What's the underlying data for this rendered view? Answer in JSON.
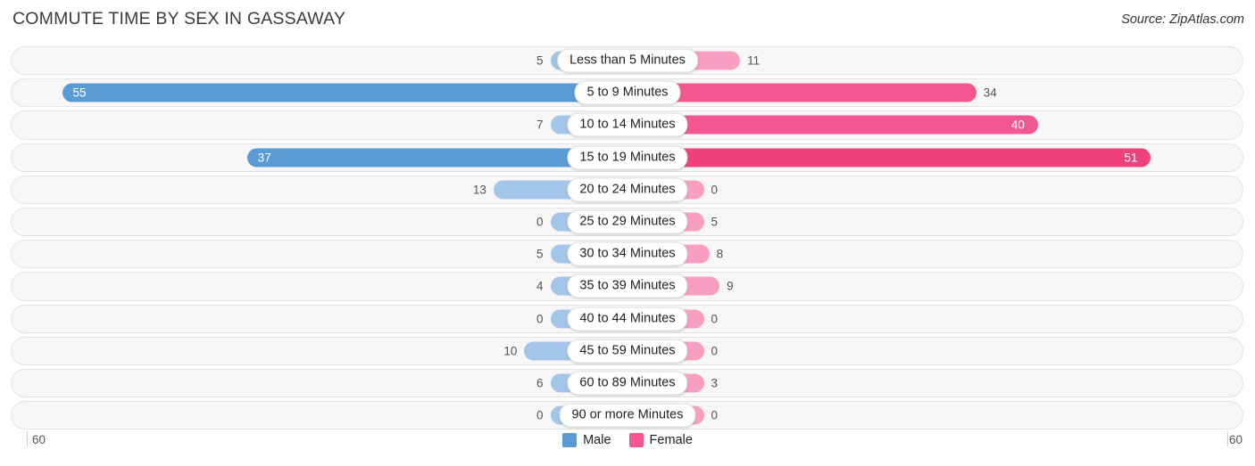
{
  "header": {
    "title": "COMMUTE TIME BY SEX IN GASSAWAY",
    "source": "Source: ZipAtlas.com"
  },
  "legend": {
    "male_label": "Male",
    "female_label": "Female",
    "male_color": "#5b9bd5",
    "female_color": "#f2588f"
  },
  "axis": {
    "left_tick": "60",
    "right_tick": "60",
    "max": 60
  },
  "chart_data": {
    "type": "bar",
    "title": "COMMUTE TIME BY SEX IN GASSAWAY",
    "subtitle": "Source: ZipAtlas.com",
    "orientation": "horizontal-diverging",
    "xlabel": "",
    "ylabel": "",
    "xlim": [
      60,
      60
    ],
    "grid": false,
    "legend_position": "bottom-center",
    "categories": [
      "Less than 5 Minutes",
      "5 to 9 Minutes",
      "10 to 14 Minutes",
      "15 to 19 Minutes",
      "20 to 24 Minutes",
      "25 to 29 Minutes",
      "30 to 34 Minutes",
      "35 to 39 Minutes",
      "40 to 44 Minutes",
      "45 to 59 Minutes",
      "60 to 89 Minutes",
      "90 or more Minutes"
    ],
    "series": [
      {
        "name": "Male",
        "values": [
          5,
          55,
          7,
          37,
          13,
          0,
          5,
          4,
          0,
          10,
          6,
          0
        ]
      },
      {
        "name": "Female",
        "values": [
          11,
          34,
          40,
          51,
          0,
          5,
          8,
          9,
          0,
          0,
          3,
          0
        ]
      }
    ]
  },
  "rows": [
    {
      "category": "Less than 5 Minutes",
      "male": 5,
      "female": 11,
      "male_text": "5",
      "female_text": "11",
      "male_inside": false,
      "female_inside": false,
      "male_shade": "light",
      "female_shade": "light"
    },
    {
      "category": "5 to 9 Minutes",
      "male": 55,
      "female": 34,
      "male_text": "55",
      "female_text": "34",
      "male_inside": true,
      "female_inside": false,
      "male_shade": "strong",
      "female_shade": "strong"
    },
    {
      "category": "10 to 14 Minutes",
      "male": 7,
      "female": 40,
      "male_text": "7",
      "female_text": "40",
      "male_inside": false,
      "female_inside": true,
      "male_shade": "light",
      "female_shade": "strong"
    },
    {
      "category": "15 to 19 Minutes",
      "male": 37,
      "female": 51,
      "male_text": "37",
      "female_text": "51",
      "male_inside": true,
      "female_inside": true,
      "male_shade": "strong",
      "female_shade": "strongest"
    },
    {
      "category": "20 to 24 Minutes",
      "male": 13,
      "female": 0,
      "male_text": "13",
      "female_text": "0",
      "male_inside": false,
      "female_inside": false,
      "male_shade": "light",
      "female_shade": "light"
    },
    {
      "category": "25 to 29 Minutes",
      "male": 0,
      "female": 5,
      "male_text": "0",
      "female_text": "5",
      "male_inside": false,
      "female_inside": false,
      "male_shade": "light",
      "female_shade": "light"
    },
    {
      "category": "30 to 34 Minutes",
      "male": 5,
      "female": 8,
      "male_text": "5",
      "female_text": "8",
      "male_inside": false,
      "female_inside": false,
      "male_shade": "light",
      "female_shade": "light"
    },
    {
      "category": "35 to 39 Minutes",
      "male": 4,
      "female": 9,
      "male_text": "4",
      "female_text": "9",
      "male_inside": false,
      "female_inside": false,
      "male_shade": "light",
      "female_shade": "light"
    },
    {
      "category": "40 to 44 Minutes",
      "male": 0,
      "female": 0,
      "male_text": "0",
      "female_text": "0",
      "male_inside": false,
      "female_inside": false,
      "male_shade": "light",
      "female_shade": "light"
    },
    {
      "category": "45 to 59 Minutes",
      "male": 10,
      "female": 0,
      "male_text": "10",
      "female_text": "0",
      "male_inside": false,
      "female_inside": false,
      "male_shade": "light",
      "female_shade": "light"
    },
    {
      "category": "60 to 89 Minutes",
      "male": 6,
      "female": 3,
      "male_text": "6",
      "female_text": "3",
      "male_inside": false,
      "female_inside": false,
      "male_shade": "light",
      "female_shade": "light"
    },
    {
      "category": "90 or more Minutes",
      "male": 0,
      "female": 0,
      "male_text": "0",
      "female_text": "0",
      "male_inside": false,
      "female_inside": false,
      "male_shade": "light",
      "female_shade": "light"
    }
  ]
}
